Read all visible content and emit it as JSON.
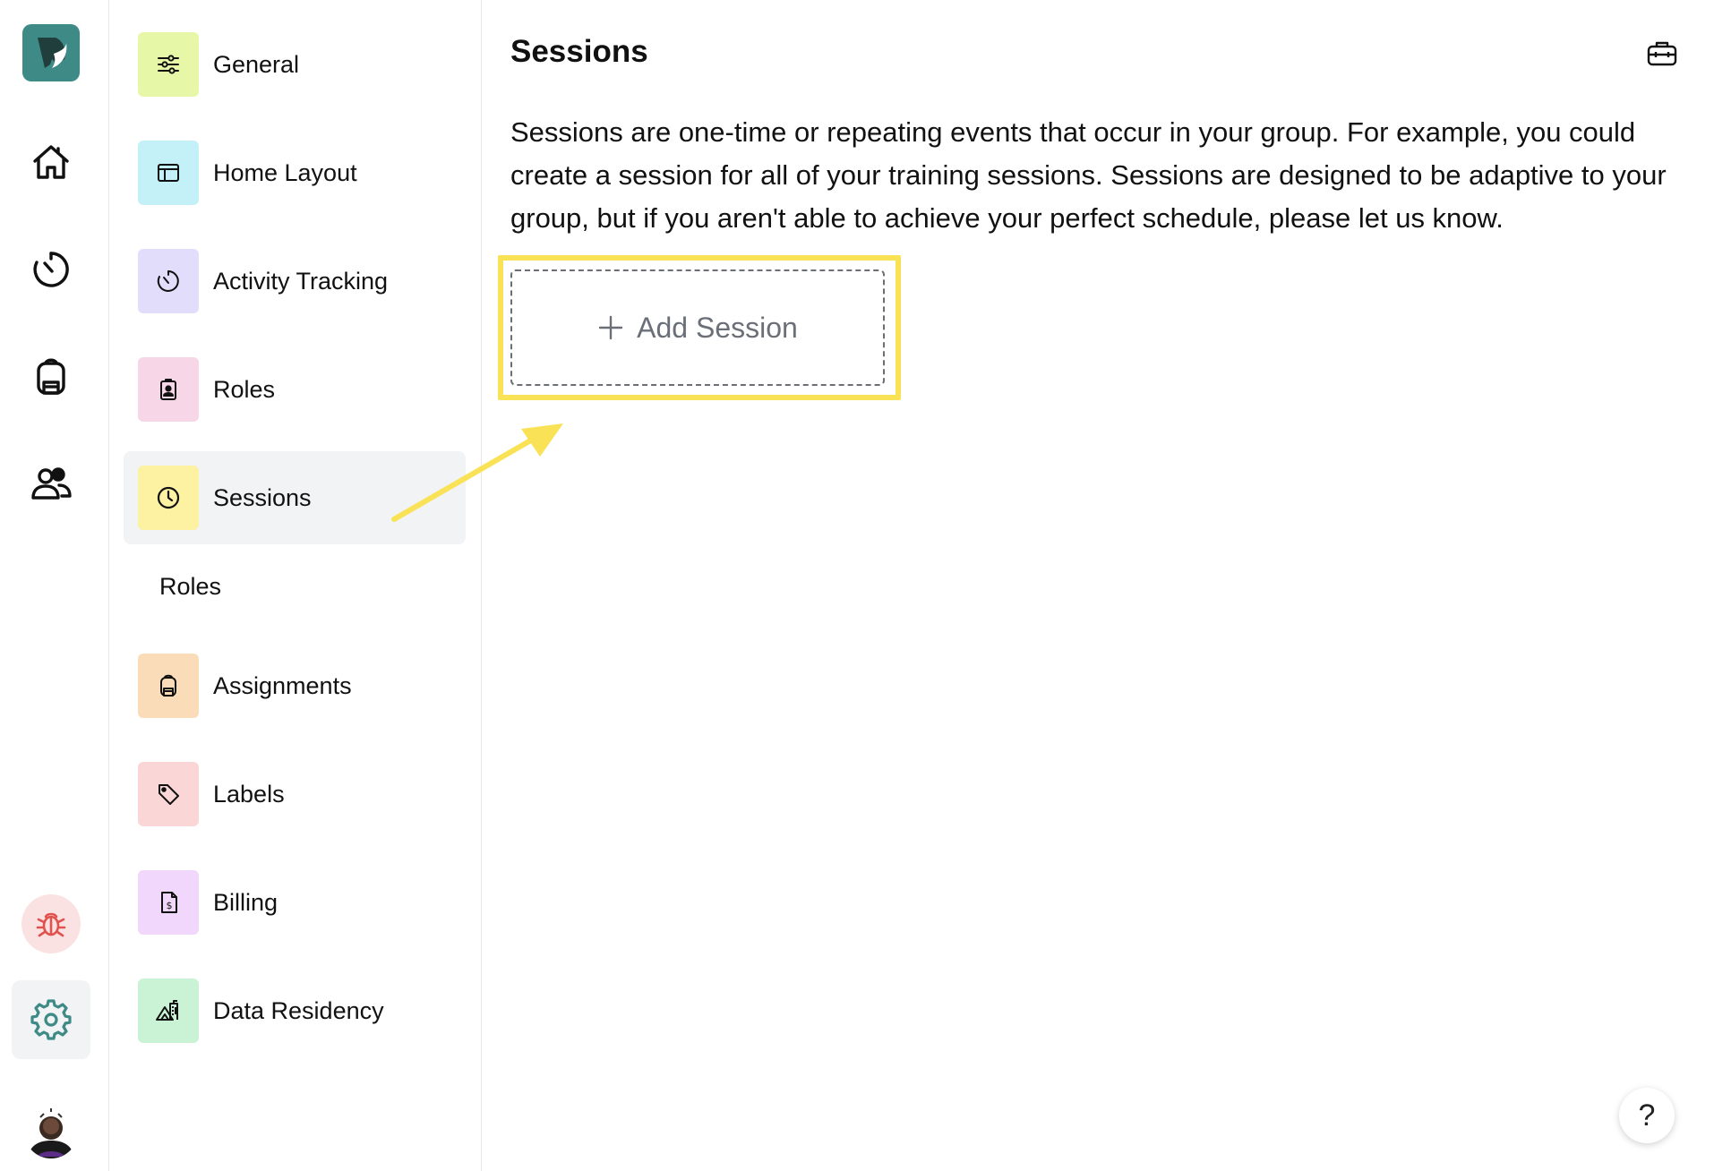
{
  "rail": {
    "items": [
      {
        "name": "logo",
        "icon": "app-logo-icon"
      },
      {
        "name": "home",
        "icon": "home-icon"
      },
      {
        "name": "activity",
        "icon": "timer-icon"
      },
      {
        "name": "assignments",
        "icon": "backpack-icon"
      },
      {
        "name": "people",
        "icon": "users-icon"
      },
      {
        "name": "bug-report",
        "icon": "bug-icon"
      },
      {
        "name": "settings",
        "icon": "gear-icon"
      },
      {
        "name": "profile",
        "icon": "avatar"
      }
    ]
  },
  "settings_nav": {
    "items": [
      {
        "label": "General",
        "icon": "sliders-icon",
        "color": "#e6f7a8"
      },
      {
        "label": "Home Layout",
        "icon": "layout-icon",
        "color": "#c4f0f7"
      },
      {
        "label": "Activity Tracking",
        "icon": "timer-icon",
        "color": "#e2ddfa"
      },
      {
        "label": "Roles",
        "icon": "badge-icon",
        "color": "#f7d6e8"
      },
      {
        "label": "Sessions",
        "icon": "clock-icon",
        "color": "#fcf2a2"
      },
      {
        "label": "Assignments",
        "icon": "backpack-icon",
        "color": "#fbdcb8"
      },
      {
        "label": "Labels",
        "icon": "tag-icon",
        "color": "#fbd6d6"
      },
      {
        "label": "Billing",
        "icon": "invoice-icon",
        "color": "#f1d7fb"
      },
      {
        "label": "Data Residency",
        "icon": "map-icon",
        "color": "#c9f3d4"
      }
    ],
    "section_label": "Roles",
    "active": "Sessions"
  },
  "main": {
    "title": "Sessions",
    "description": "Sessions are one-time or repeating events that occur in your group. For example, you could create a session for all of your training sessions. Sessions are designed to be adaptive to your group, but if you aren't able to achieve your perfect schedule, please let us know.",
    "add_button_label": "Add Session",
    "help_label": "?"
  },
  "colors": {
    "brand": "#3d8a86",
    "highlight": "#f9e256",
    "active_bg": "#f2f3f5"
  }
}
